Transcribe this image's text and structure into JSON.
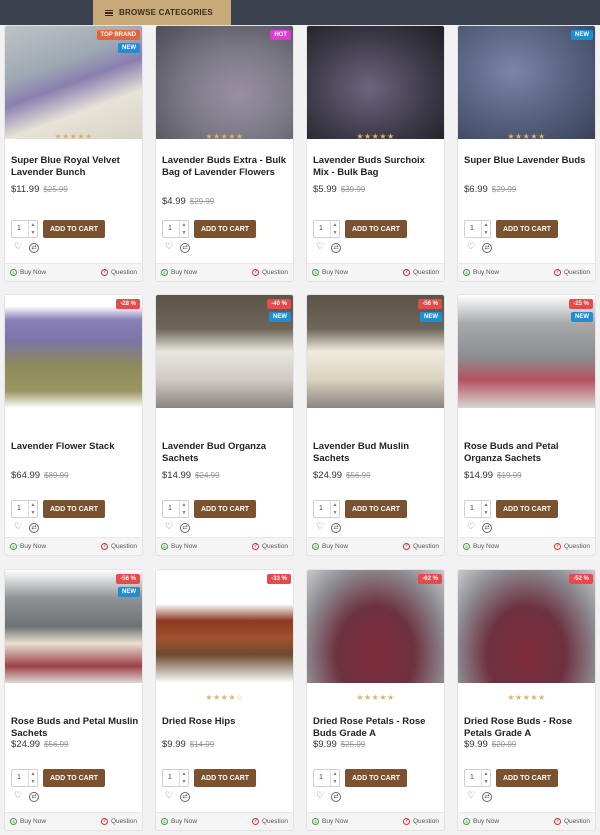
{
  "header": {
    "browse_label": "BROWSE CATEGORIES"
  },
  "labels": {
    "add_to_cart": "ADD TO CART",
    "buy_now": "Buy Now",
    "question": "Question",
    "qty_default": "1"
  },
  "products": [
    {
      "name": "Super Blue Royal Velvet Lavender Bunch",
      "price": "$11.99",
      "old_price": "$25.99",
      "badges": [
        "TOP BRAND",
        "NEW"
      ],
      "stars": "★★★★★"
    },
    {
      "name": "Lavender Buds Extra - Bulk Bag of Lavender Flowers",
      "price": "$4.99",
      "old_price": "$29.99",
      "badges": [
        "HOT"
      ],
      "stars": "★★★★★"
    },
    {
      "name": "Lavender Buds Surchoix Mix - Bulk Bag",
      "price": "$5.99",
      "old_price": "$39.99",
      "badges": [],
      "stars": "★★★★★"
    },
    {
      "name": "Super Blue Lavender Buds",
      "price": "$6.99",
      "old_price": "$29.99",
      "badges": [
        "NEW"
      ],
      "stars": "★★★★★"
    },
    {
      "name": "Lavender Flower Stack",
      "price": "$64.99",
      "old_price": "$89.99",
      "badges": [
        "-28 %"
      ],
      "stars": ""
    },
    {
      "name": "Lavender Bud Organza Sachets",
      "price": "$14.99",
      "old_price": "$24.99",
      "badges": [
        "-40 %",
        "NEW"
      ],
      "stars": ""
    },
    {
      "name": "Lavender Bud Muslin Sachets",
      "price": "$24.99",
      "old_price": "$56.99",
      "badges": [
        "-56 %",
        "NEW"
      ],
      "stars": ""
    },
    {
      "name": "Rose Buds and Petal Organza Sachets",
      "price": "$14.99",
      "old_price": "$19.99",
      "badges": [
        "-25 %",
        "NEW"
      ],
      "stars": ""
    },
    {
      "name": "Rose Buds and Petal Muslin Sachets",
      "price": "$24.99",
      "old_price": "$56.99",
      "badges": [
        "-56 %",
        "NEW"
      ],
      "stars": ""
    },
    {
      "name": "Dried Rose Hips",
      "price": "$9.99",
      "old_price": "$14.99",
      "badges": [
        "-33 %"
      ],
      "stars": "★★★★☆"
    },
    {
      "name": "Dried Rose Petals - Rose Buds Grade A",
      "price": "$9.99",
      "old_price": "$25.99",
      "badges": [
        "-62 %"
      ],
      "stars": "★★★★★"
    },
    {
      "name": "Dried Rose Buds - Rose Petals Grade A",
      "price": "$9.99",
      "old_price": "$20.99",
      "badges": [
        "-52 %"
      ],
      "stars": "★★★★★"
    }
  ]
}
